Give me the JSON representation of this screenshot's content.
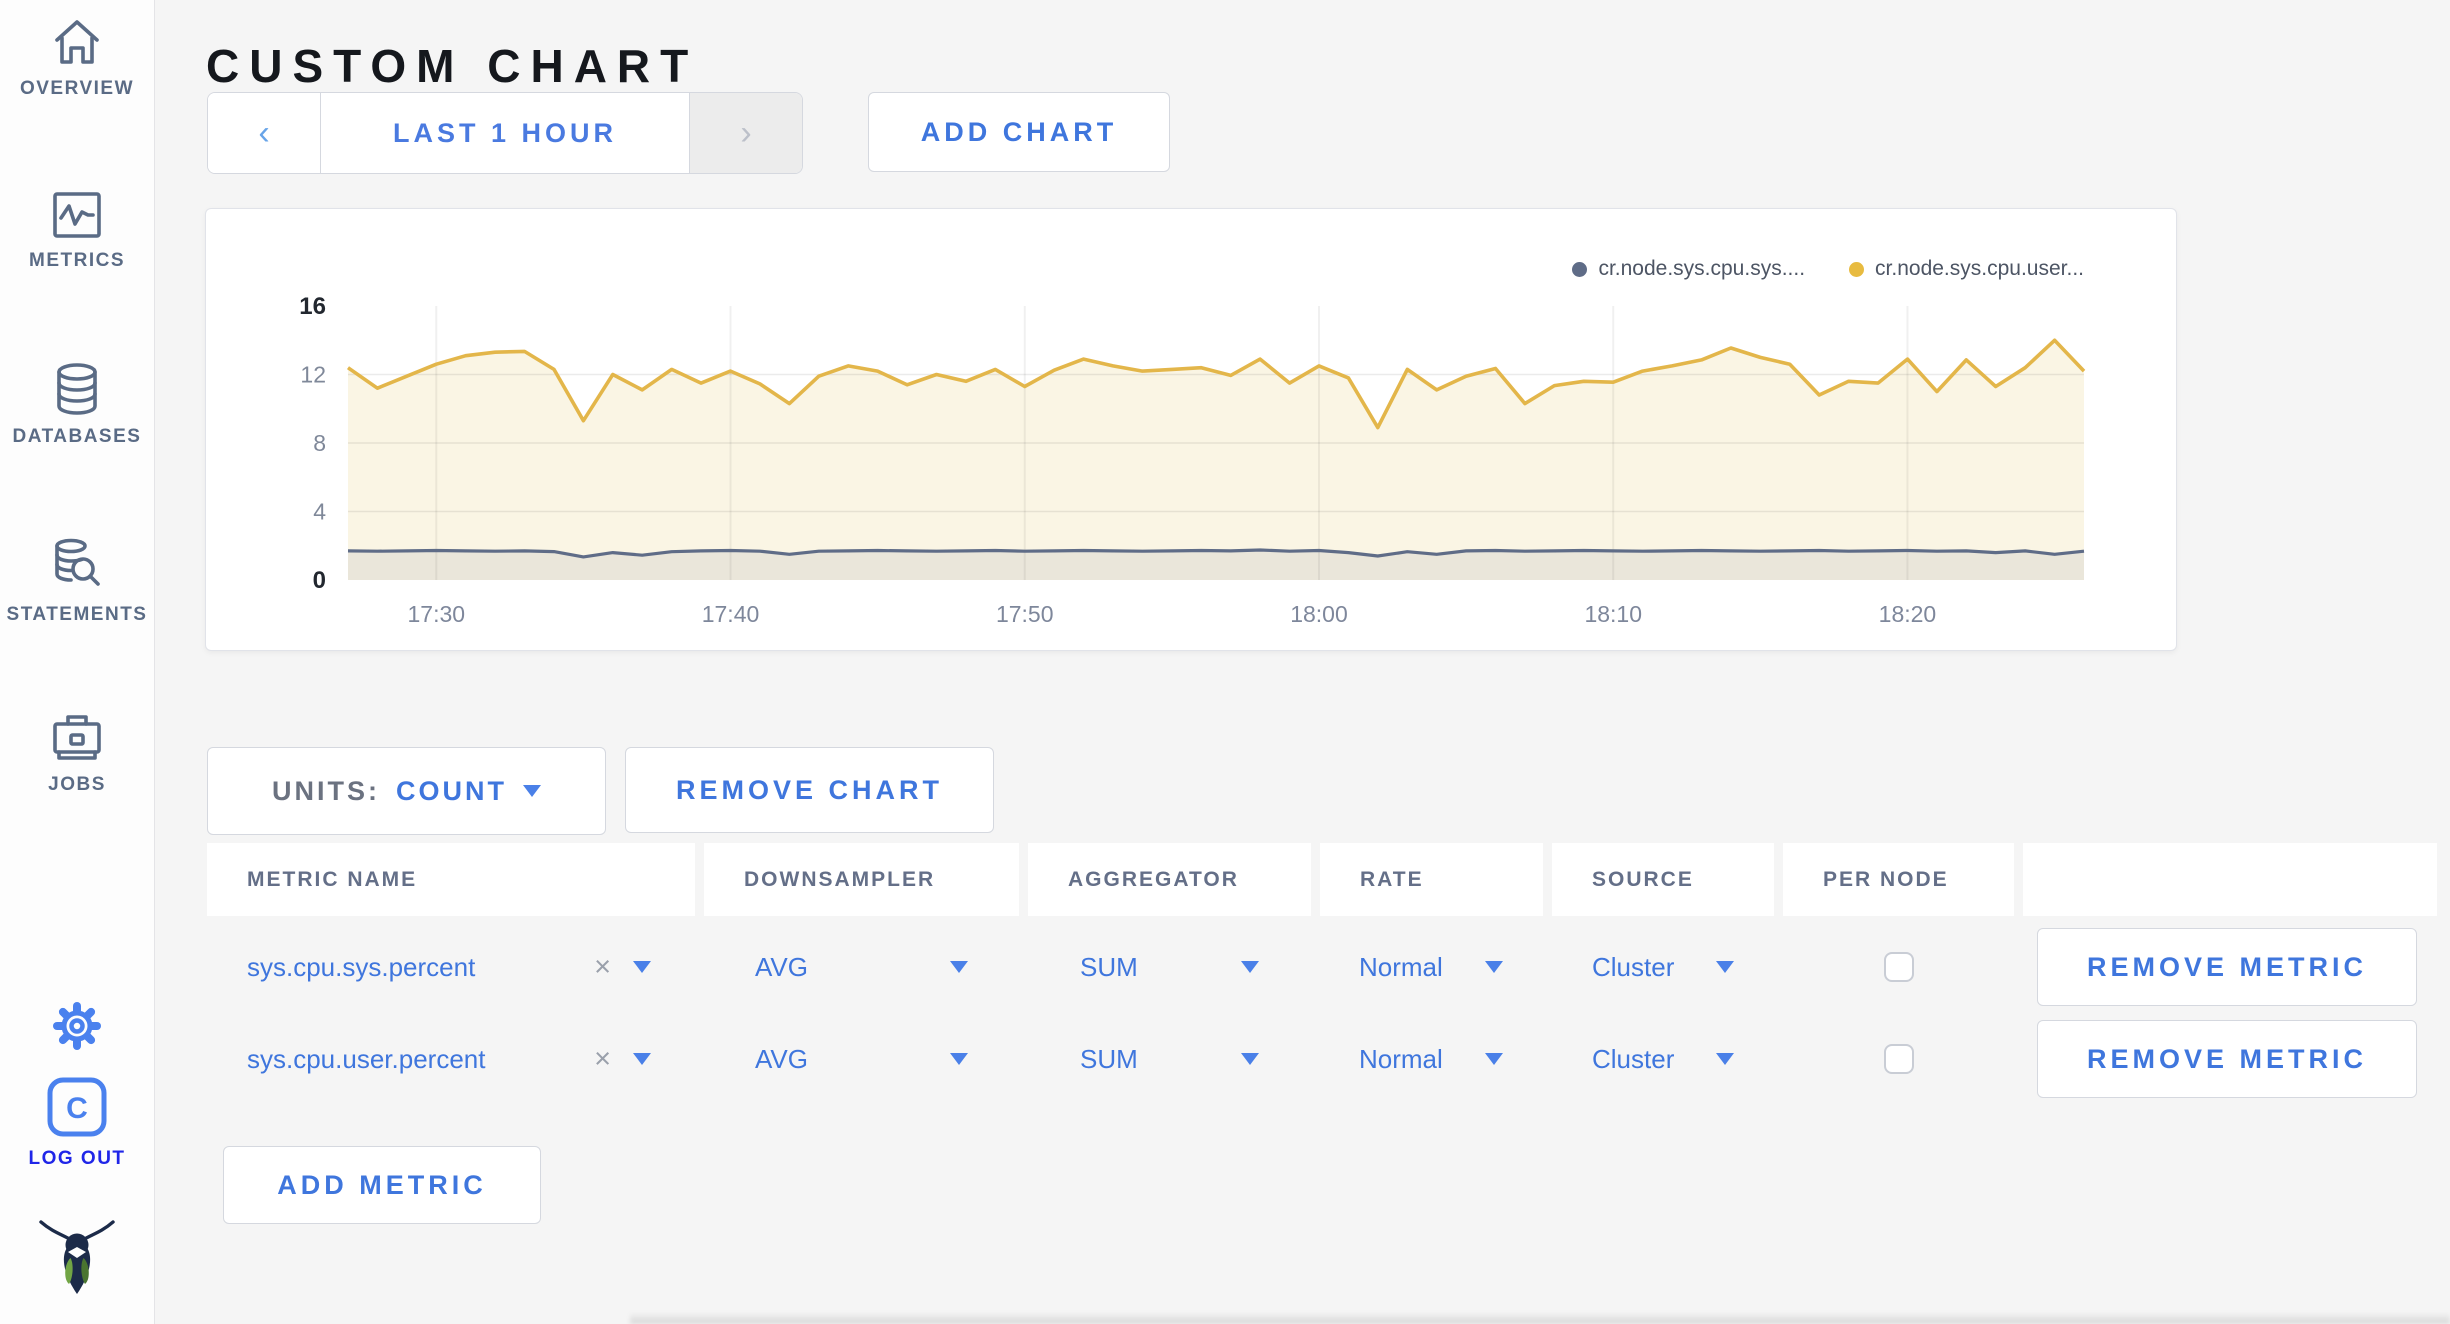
{
  "page": {
    "title": "CUSTOM CHART"
  },
  "sidebar": {
    "items": [
      {
        "label": "OVERVIEW",
        "icon": "home-icon"
      },
      {
        "label": "METRICS",
        "icon": "metrics-icon"
      },
      {
        "label": "DATABASES",
        "icon": "database-icon"
      },
      {
        "label": "STATEMENTS",
        "icon": "statements-icon"
      },
      {
        "label": "JOBS",
        "icon": "briefcase-icon"
      }
    ],
    "logout_label": "LOG OUT"
  },
  "toolbar": {
    "prev_arrow": "‹",
    "next_arrow": "›",
    "time_range_label": "LAST 1 HOUR",
    "add_chart_label": "ADD CHART"
  },
  "legend": [
    {
      "label": "cr.node.sys.cpu.sys....",
      "color": "#5f6c87"
    },
    {
      "label": "cr.node.sys.cpu.user...",
      "color": "#e8bb40"
    }
  ],
  "chart_data": {
    "type": "line",
    "title": "",
    "xlabel": "",
    "ylabel": "",
    "ylim": [
      0,
      16
    ],
    "yticks": [
      0,
      4,
      8,
      12,
      16
    ],
    "xticks": [
      "17:30",
      "17:40",
      "17:50",
      "18:00",
      "18:10",
      "18:20"
    ],
    "grid": true,
    "legend_position": "top-right",
    "x": [
      "17:27",
      "17:28",
      "17:29",
      "17:30",
      "17:31",
      "17:32",
      "17:33",
      "17:34",
      "17:35",
      "17:36",
      "17:37",
      "17:38",
      "17:39",
      "17:40",
      "17:41",
      "17:42",
      "17:43",
      "17:44",
      "17:45",
      "17:46",
      "17:47",
      "17:48",
      "17:49",
      "17:50",
      "17:51",
      "17:52",
      "17:53",
      "17:54",
      "17:55",
      "17:56",
      "17:57",
      "17:58",
      "17:59",
      "18:00",
      "18:01",
      "18:02",
      "18:03",
      "18:04",
      "18:05",
      "18:06",
      "18:07",
      "18:08",
      "18:09",
      "18:10",
      "18:11",
      "18:12",
      "18:13",
      "18:14",
      "18:15",
      "18:16",
      "18:17",
      "18:18",
      "18:19",
      "18:20",
      "18:21",
      "18:22",
      "18:23",
      "18:24",
      "18:25",
      "18:26"
    ],
    "series": [
      {
        "name": "cr.node.sys.cpu.sys....",
        "color": "#5f6c87",
        "fill": "#eae6da",
        "values": [
          1.7,
          1.68,
          1.7,
          1.72,
          1.7,
          1.68,
          1.7,
          1.66,
          1.35,
          1.6,
          1.45,
          1.65,
          1.7,
          1.72,
          1.68,
          1.5,
          1.68,
          1.7,
          1.72,
          1.7,
          1.68,
          1.7,
          1.72,
          1.68,
          1.7,
          1.72,
          1.7,
          1.68,
          1.7,
          1.72,
          1.7,
          1.75,
          1.68,
          1.72,
          1.6,
          1.4,
          1.65,
          1.5,
          1.7,
          1.72,
          1.68,
          1.7,
          1.72,
          1.7,
          1.68,
          1.7,
          1.72,
          1.7,
          1.68,
          1.7,
          1.72,
          1.68,
          1.7,
          1.72,
          1.68,
          1.7,
          1.6,
          1.7,
          1.5,
          1.68
        ]
      },
      {
        "name": "cr.node.sys.cpu.user...",
        "color": "#e3b64a",
        "fill": "#faf5e4",
        "values": [
          12.4,
          11.2,
          11.9,
          12.6,
          13.1,
          13.3,
          13.35,
          12.3,
          9.3,
          12.0,
          11.1,
          12.3,
          11.5,
          12.2,
          11.45,
          10.3,
          11.9,
          12.5,
          12.2,
          11.4,
          12.0,
          11.6,
          12.3,
          11.3,
          12.25,
          12.9,
          12.5,
          12.2,
          12.3,
          12.4,
          11.95,
          12.9,
          11.5,
          12.5,
          11.8,
          8.9,
          12.3,
          11.1,
          11.9,
          12.35,
          10.3,
          11.35,
          11.6,
          11.55,
          12.2,
          12.5,
          12.85,
          13.55,
          13.0,
          12.6,
          10.8,
          11.6,
          11.5,
          12.9,
          11.0,
          12.85,
          11.3,
          12.4,
          14.0,
          12.2
        ]
      }
    ]
  },
  "chart_controls": {
    "units_label": "UNITS:",
    "units_value": "COUNT",
    "remove_chart_label": "REMOVE CHART",
    "add_metric_label": "ADD METRIC"
  },
  "table": {
    "headers": [
      "METRIC NAME",
      "DOWNSAMPLER",
      "AGGREGATOR",
      "RATE",
      "SOURCE",
      "PER NODE",
      ""
    ],
    "rows": [
      {
        "metric": "sys.cpu.sys.percent",
        "downsampler": "AVG",
        "aggregator": "SUM",
        "rate": "Normal",
        "source": "Cluster",
        "per_node": false,
        "remove_label": "REMOVE METRIC"
      },
      {
        "metric": "sys.cpu.user.percent",
        "downsampler": "AVG",
        "aggregator": "SUM",
        "rate": "Normal",
        "source": "Cluster",
        "per_node": false,
        "remove_label": "REMOVE METRIC"
      }
    ]
  }
}
